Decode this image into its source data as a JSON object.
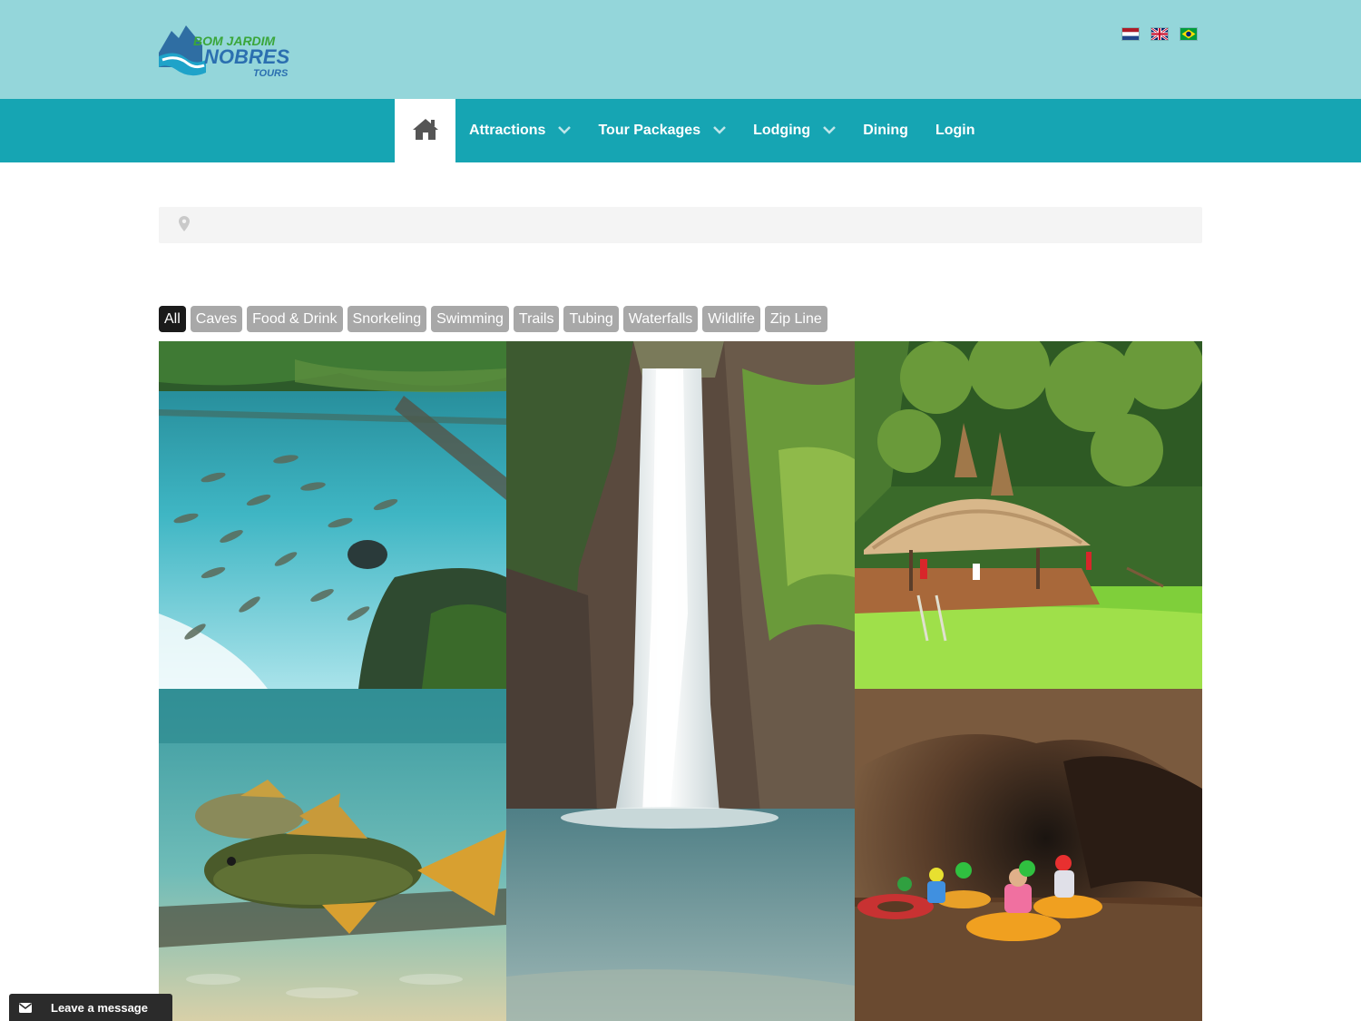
{
  "brand": {
    "logo_line1": "BOM JARDIM",
    "logo_line2": "NOBRES",
    "logo_line3": "TOURS",
    "header_color": "#94d6da",
    "nav_color": "#16a5b3"
  },
  "languages": [
    {
      "name": "Dutch",
      "icon": "netherlands-flag-icon"
    },
    {
      "name": "English",
      "icon": "uk-flag-icon"
    },
    {
      "name": "Portuguese",
      "icon": "brazil-flag-icon"
    }
  ],
  "nav": {
    "home_icon": "home-icon",
    "items": [
      {
        "label": "Attractions",
        "has_dropdown": true
      },
      {
        "label": "Tour Packages",
        "has_dropdown": true
      },
      {
        "label": "Lodging",
        "has_dropdown": true
      },
      {
        "label": "Dining",
        "has_dropdown": false
      },
      {
        "label": "Login",
        "has_dropdown": false
      }
    ]
  },
  "search": {
    "icon": "map-pin-icon",
    "value": "",
    "placeholder": ""
  },
  "filters": {
    "items": [
      "All",
      "Caves",
      "Food & Drink",
      "Snorkeling",
      "Swimming",
      "Trails",
      "Tubing",
      "Waterfalls",
      "Wildlife",
      "Zip Line"
    ],
    "active": "All"
  },
  "gallery": {
    "tiles": [
      {
        "subject": "clear blue spring with fish"
      },
      {
        "subject": "waterfall into pool"
      },
      {
        "subject": "thatched hut by green lagoon"
      },
      {
        "subject": "underwater fish"
      },
      {
        "subject": "cave tubing with helmets"
      }
    ]
  },
  "chat": {
    "icon": "envelope-icon",
    "label": "Leave a message"
  }
}
